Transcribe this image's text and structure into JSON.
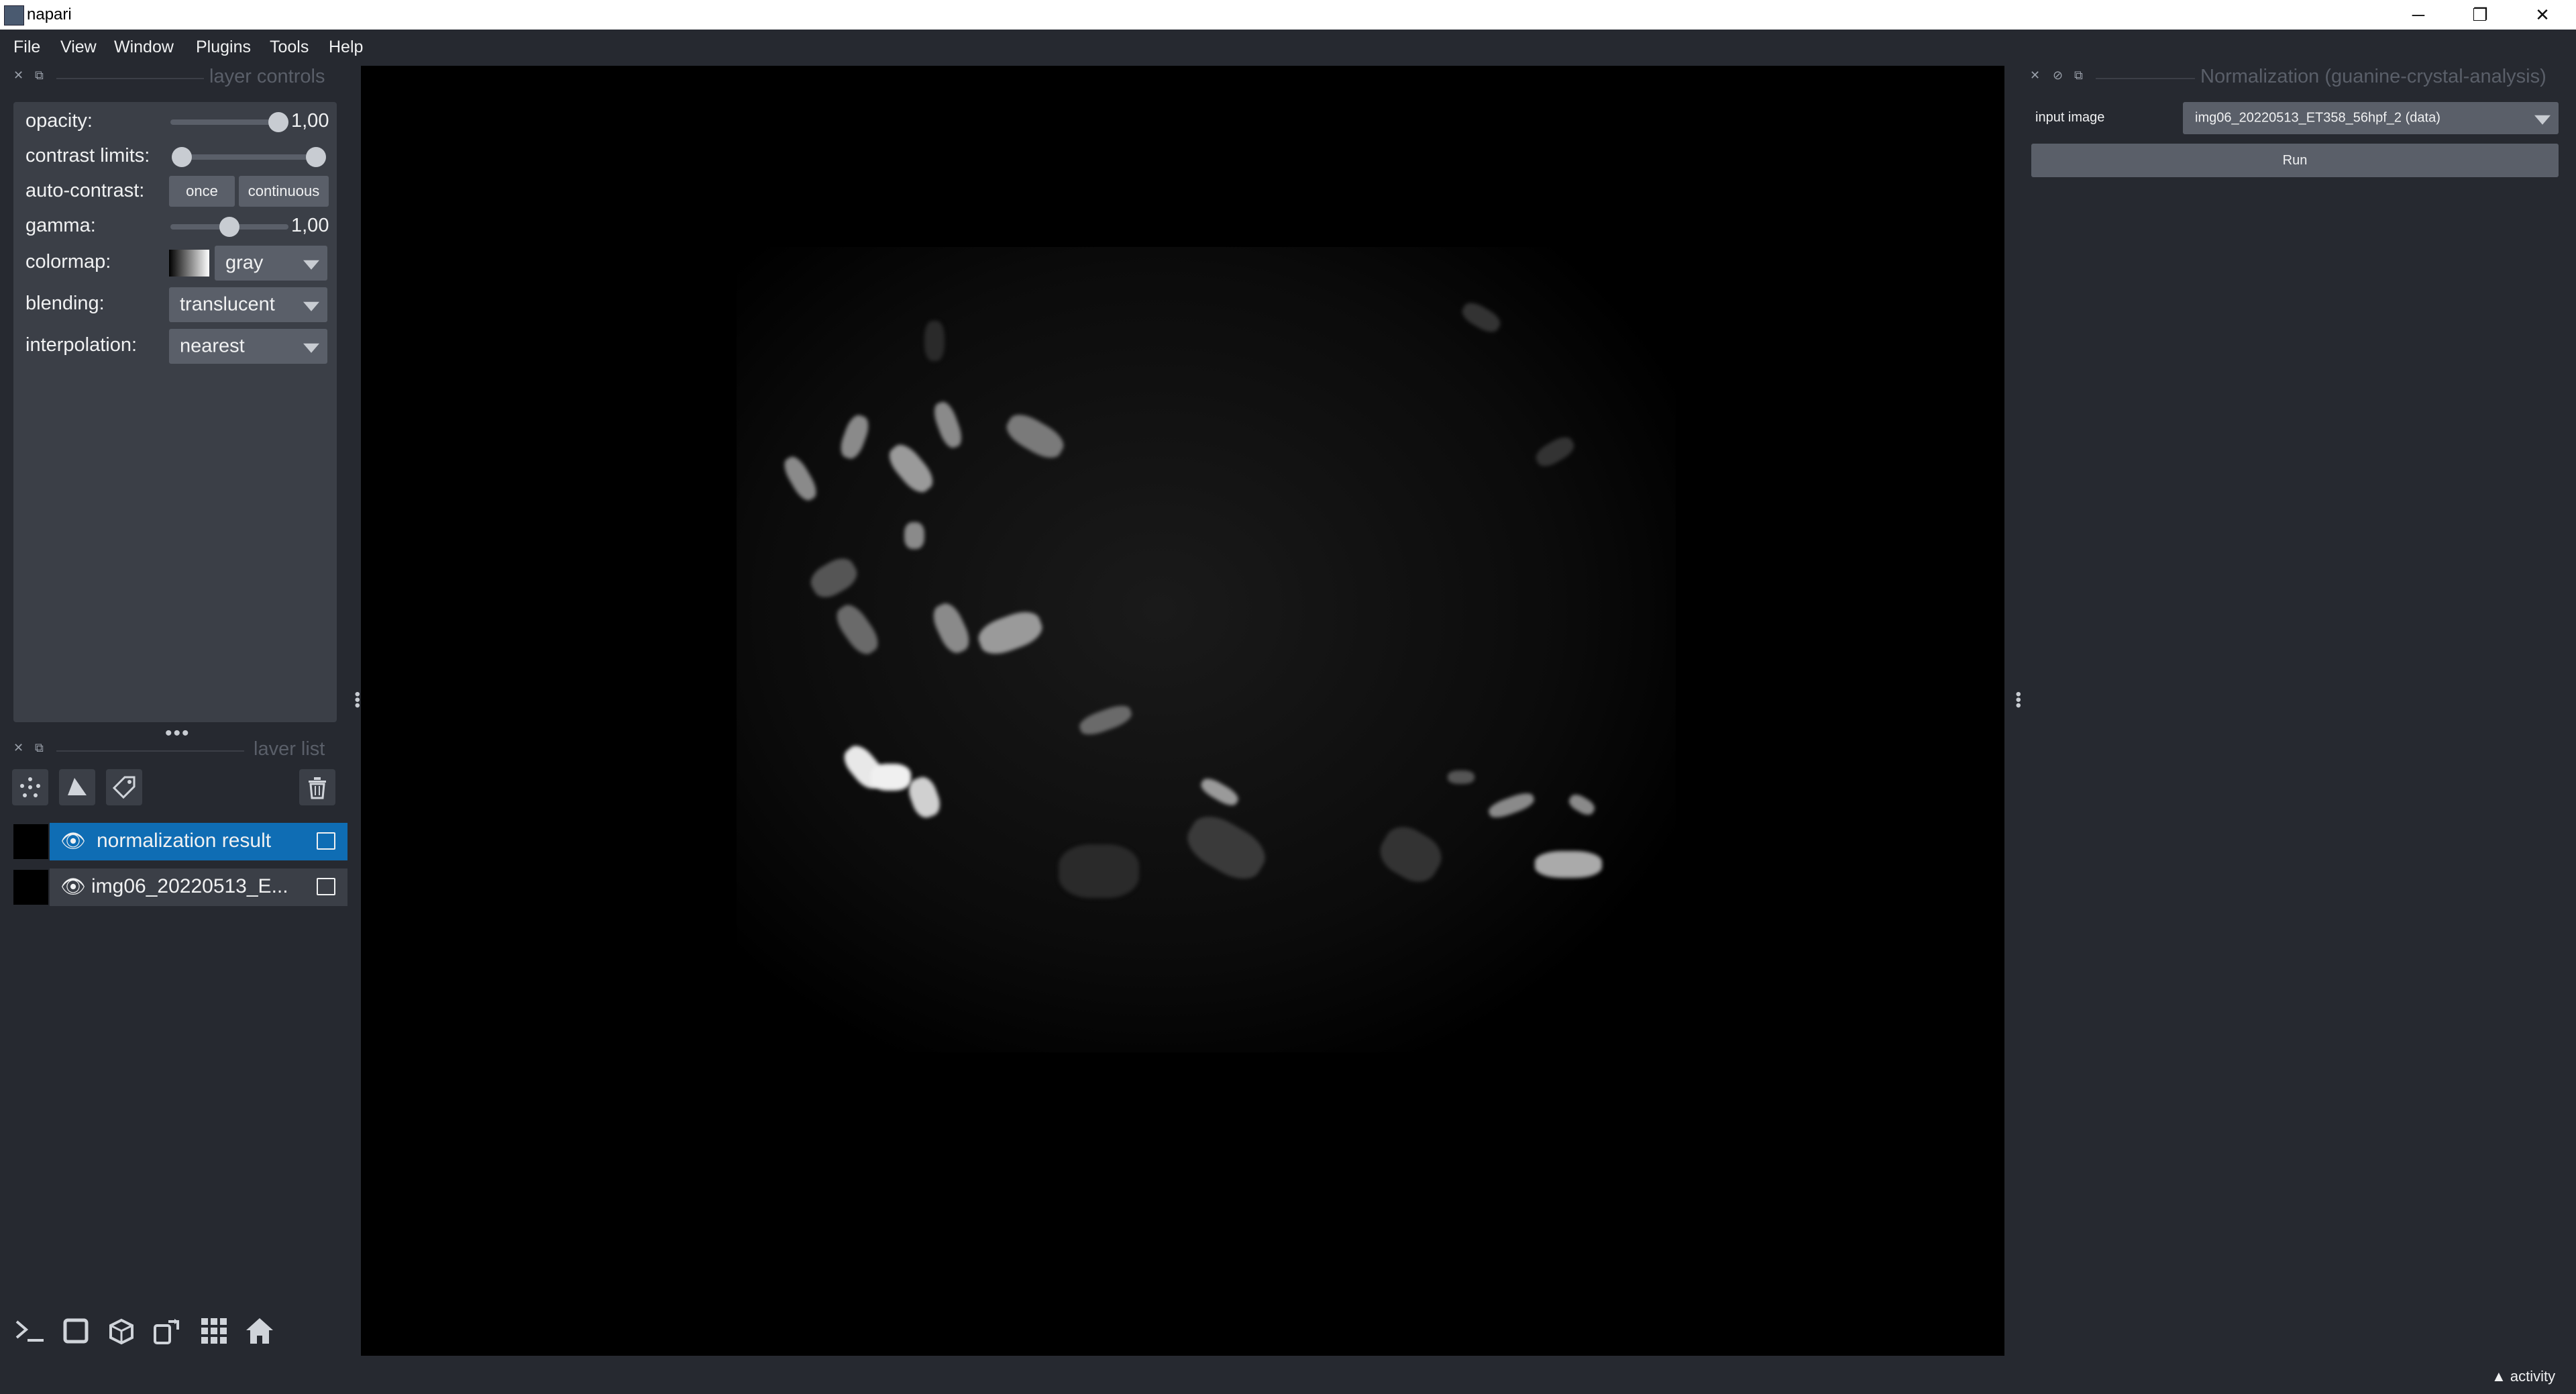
{
  "window": {
    "title": "napari",
    "controls": [
      "─",
      "❐",
      "✕"
    ]
  },
  "menu": [
    "File",
    "View",
    "Window",
    "Plugins",
    "Tools",
    "Help"
  ],
  "layer_controls": {
    "header": "layer controls",
    "opacity_label": "opacity:",
    "opacity_value": "1,00",
    "opacity_level": 1.0,
    "contrast_label": "contrast limits:",
    "contrast_range": [
      0.0,
      1.0
    ],
    "autocontrast_label": "auto-contrast:",
    "once_label": "once",
    "continuous_label": "continuous",
    "gamma_label": "gamma:",
    "gamma_value": "1,00",
    "gamma_level": 0.5,
    "colormap_label": "colormap:",
    "colormap_value": "gray",
    "blending_label": "blending:",
    "blending_value": "translucent",
    "interpolation_label": "interpolation:",
    "interpolation_value": "nearest"
  },
  "layer_list": {
    "header": "laver list",
    "layers": [
      {
        "name": "normalization result",
        "selected": true
      },
      {
        "name": "img06_20220513_E...",
        "selected": false
      }
    ]
  },
  "plugin_panel": {
    "title": "Normalization (guanine-crystal-analysis)",
    "input_label": "input image",
    "input_value": "img06_20220513_ET358_56hpf_2 (data)",
    "run_label": "Run"
  },
  "status": {
    "activity_label": "activity"
  },
  "colors": {
    "bg": "#262930",
    "panel": "#3b3f47",
    "button": "#5a5f69",
    "selected": "#0f6db4"
  }
}
